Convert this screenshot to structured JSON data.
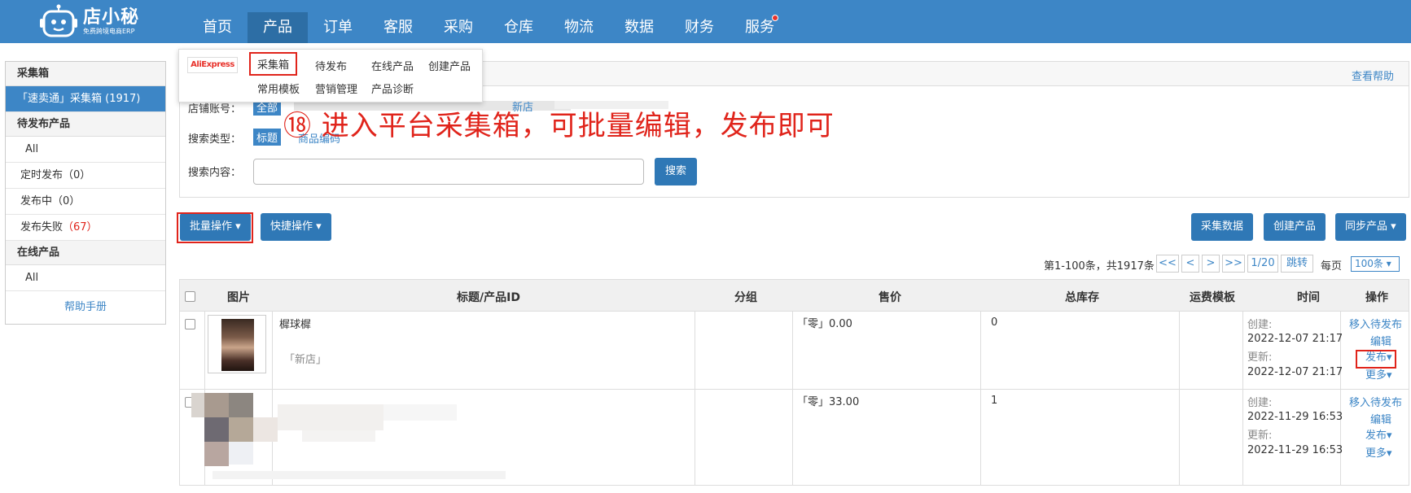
{
  "brand": {
    "name": "店小秘",
    "tagline": "免费跨境电商ERP"
  },
  "nav": {
    "items": [
      "首页",
      "产品",
      "订单",
      "客服",
      "采购",
      "仓库",
      "物流",
      "数据",
      "财务",
      "服务"
    ],
    "active": "产品"
  },
  "dropdown": {
    "platform": "AliExpress",
    "row1": [
      "采集箱",
      "待发布",
      "在线产品",
      "创建产品"
    ],
    "row2": [
      "常用模板",
      "营销管理",
      "产品诊断"
    ],
    "selected": "采集箱"
  },
  "sidebar": {
    "collect_box_header": "采集箱",
    "collect_box_item": "「速卖通」采集箱 (1917)",
    "pending_header": "待发布产品",
    "pending_all": "All",
    "scheduled_label": "定时发布",
    "scheduled_count": "（0）",
    "publishing_label": "发布中",
    "publishing_count": "（0）",
    "failed_label": "发布失败",
    "failed_count": "（67）",
    "online_header": "在线产品",
    "online_all": "All",
    "help": "帮助手册"
  },
  "panel": {
    "help_link": "查看帮助",
    "shop_label": "店铺账号：",
    "shop_all": "全部",
    "shop_new": "新店",
    "search_type_label": "搜索类型：",
    "search_type_title": "标题",
    "search_type_code": "商品编码",
    "search_content_label": "搜索内容：",
    "search_input_value": "",
    "search_button": "搜索"
  },
  "annotation": "⑱ 进入平台采集箱，可批量编辑，发布即可",
  "toolbar": {
    "batch": "批量操作 ▾",
    "quick": "快捷操作 ▾",
    "collect_data": "采集数据",
    "create_product": "创建产品",
    "sync_product": "同步产品 ▾"
  },
  "pager": {
    "summary": "第1-100条，共1917条",
    "first": "<<",
    "prev": "<",
    "next": ">",
    "last": ">>",
    "page": "1/20",
    "jump": "跳转",
    "per_page_label": "每页",
    "per_page_value": "100条"
  },
  "table": {
    "headers": [
      "图片",
      "标题/产品ID",
      "分组",
      "售价",
      "总库存",
      "运费模板",
      "时间",
      "操作"
    ],
    "rows": [
      {
        "title": "樨球樨",
        "shop": "「新店」",
        "price": "「零」0.00",
        "stock": "0",
        "created_label": "创建:",
        "created": "2022-12-07 21:17",
        "updated_label": "更新:",
        "updated": "2022-12-07 21:17",
        "actions": [
          "移入待发布",
          "编辑",
          "发布",
          "更多"
        ]
      },
      {
        "title": "",
        "shop": "",
        "price": "「零」33.00",
        "stock": "1",
        "created_label": "创建:",
        "created": "2022-11-29 16:53",
        "updated_label": "更新:",
        "updated": "2022-11-29 16:53",
        "actions": [
          "移入待发布",
          "编辑",
          "发布",
          "更多"
        ]
      }
    ]
  },
  "colors": {
    "primary": "#3d86c6",
    "highlight": "#e0241b",
    "button": "#2f78b6"
  }
}
